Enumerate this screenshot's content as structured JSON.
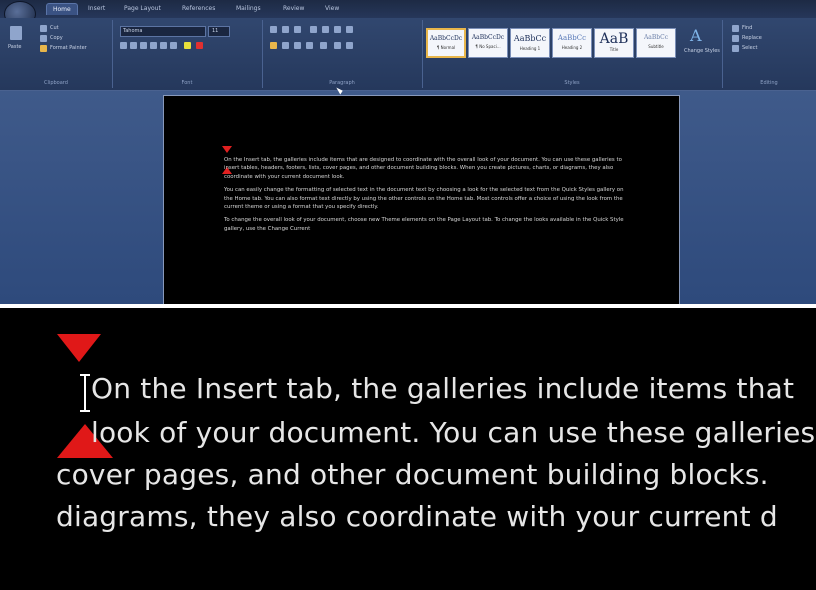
{
  "ribbon": {
    "tabs": [
      "Home",
      "Insert",
      "Page Layout",
      "References",
      "Mailings",
      "Review",
      "View"
    ],
    "clipboard": {
      "paste_label": "Paste",
      "cut": "Cut",
      "copy": "Copy",
      "format_painter": "Format Painter",
      "group_label": "Clipboard"
    },
    "font": {
      "name": "Tahoma",
      "size": "11",
      "group_label": "Font"
    },
    "paragraph": {
      "group_label": "Paragraph"
    },
    "styles": {
      "group_label": "Styles",
      "items": [
        {
          "sample": "AaBbCcDc",
          "name": "¶ Normal"
        },
        {
          "sample": "AaBbCcDc",
          "name": "¶ No Spaci..."
        },
        {
          "sample": "AaBbCc",
          "name": "Heading 1"
        },
        {
          "sample": "AaBbCc",
          "name": "Heading 2"
        },
        {
          "sample": "AaB",
          "name": "Title"
        },
        {
          "sample": "AaBbCc",
          "name": "Subtitle"
        }
      ],
      "change_styles": "Change Styles"
    },
    "editing": {
      "find": "Find",
      "replace": "Replace",
      "select": "Select",
      "group_label": "Editing"
    }
  },
  "document": {
    "paragraphs": [
      "On the Insert tab, the galleries include items that are designed to coordinate with the overall look of your document. You can use these galleries to insert tables, headers, footers, lists, cover pages, and other document building blocks. When you create pictures, charts, or diagrams, they also coordinate with your current document look.",
      "You can easily change the formatting of selected text in the document text by choosing a look for the selected text from the Quick Styles gallery on the Home tab. You can also format text directly by using the other controls on the Home tab. Most controls offer a choice of using the look from the current theme or using a format that you specify directly.",
      "To change the overall look of your document, choose new Theme elements on the Page Layout tab. To change the looks available in the Quick Style gallery, use the Change Current"
    ]
  },
  "zoom": {
    "lines": [
      "On the Insert tab, the galleries include items that",
      "look of your document. You can use these galleries",
      "cover pages, and other document building blocks.",
      "diagrams, they also coordinate with your current d"
    ]
  },
  "colors": {
    "indent_marker": "#e01818",
    "ribbon": "#2b3f66",
    "document_bg": "#000000",
    "selected_style": "#e8b64b"
  }
}
